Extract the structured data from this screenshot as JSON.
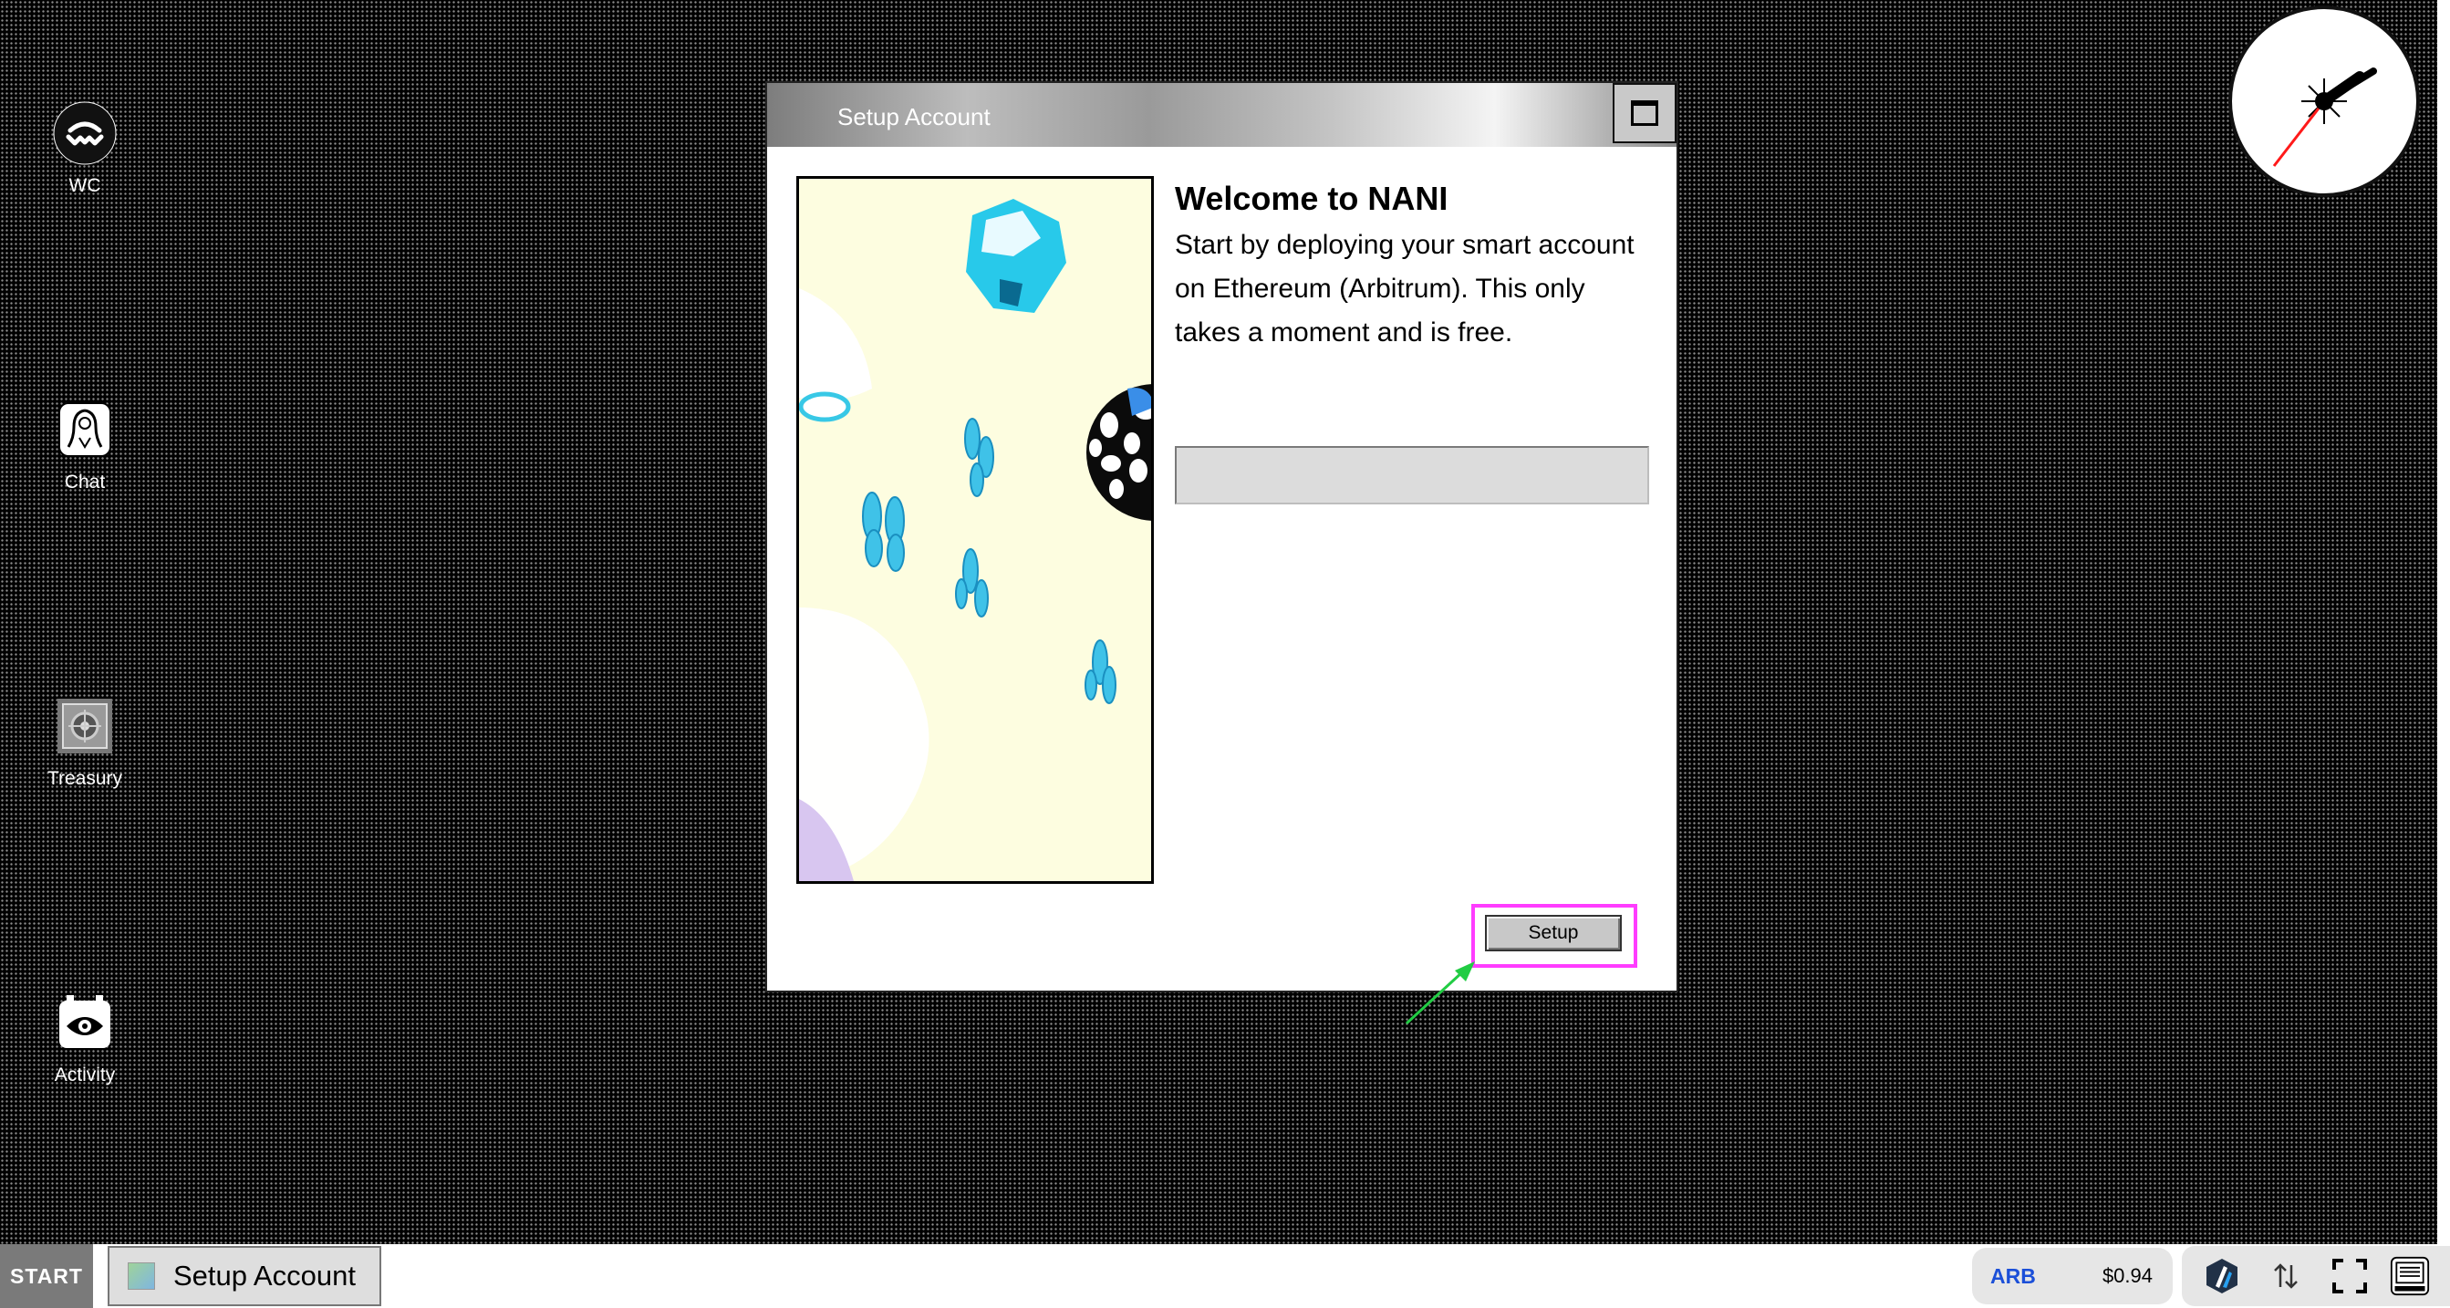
{
  "desktop": {
    "icons": [
      {
        "label": "WC"
      },
      {
        "label": "Chat"
      },
      {
        "label": "Treasury"
      },
      {
        "label": "Activity"
      }
    ]
  },
  "window": {
    "title": "Setup Account",
    "heading": "Welcome to NANI",
    "description": "Start by deploying your smart account on Ethereum (Arbitrum). This only takes a moment and is free.",
    "input_value": "",
    "setup_label": "Setup"
  },
  "taskbar": {
    "start_label": "START",
    "task_label": "Setup Account",
    "token_symbol": "ARB",
    "token_price": "$0.94"
  },
  "colors": {
    "highlight": "#ff3cff",
    "arrow": "#22cc44",
    "token": "#1b4fd8"
  },
  "icons": [
    "walletconnect-icon",
    "chat-icon",
    "treasury-icon",
    "activity-icon",
    "clock-icon",
    "maximize-icon",
    "arbitrum-icon",
    "swap-icon",
    "fullscreen-icon",
    "computer-icon"
  ]
}
